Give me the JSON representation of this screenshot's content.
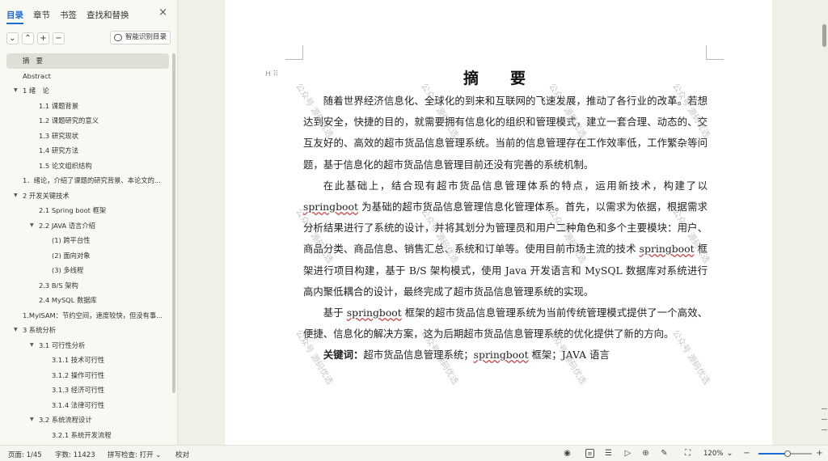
{
  "sidebar": {
    "tabs": [
      "目录",
      "章节",
      "书签",
      "查找和替换"
    ],
    "active_tab": 0,
    "close_icon": "×",
    "toolbar": {
      "collapse": "⌄",
      "expand": "⌃",
      "add": "+",
      "remove": "−",
      "smart_label": "智能识别目录"
    },
    "toc": [
      {
        "label": "摘　要",
        "level": 0,
        "selected": true
      },
      {
        "label": "Abstract",
        "level": 0
      },
      {
        "label": "1 绪　论",
        "level": 0,
        "arrow": true
      },
      {
        "label": "1.1 课题背景",
        "level": 1
      },
      {
        "label": "1.2 课题研究的意义",
        "level": 1
      },
      {
        "label": "1.3 研究现状",
        "level": 1
      },
      {
        "label": "1.4 研究方法",
        "level": 1
      },
      {
        "label": "1.5 论文组织结构",
        "level": 1
      },
      {
        "label": "1．绪论，介绍了课题的研究背景、本论文的...",
        "level": 0
      },
      {
        "label": "2 开发关键技术",
        "level": 0,
        "arrow": true
      },
      {
        "label": "2.1 Spring boot 框架",
        "level": 1
      },
      {
        "label": "2.2 JAVA 语言介绍",
        "level": 1,
        "arrow": true
      },
      {
        "label": "(1)  跨平台性",
        "level": 2
      },
      {
        "label": "(2)  面向对象",
        "level": 2
      },
      {
        "label": "(3)  多线程",
        "level": 2
      },
      {
        "label": "2.3 B/S 架构",
        "level": 1
      },
      {
        "label": "2.4 MySQL 数据库",
        "level": 1
      },
      {
        "label": "1.MyISAM：节约空间，速度较快，但没有事...",
        "level": 0
      },
      {
        "label": "3 系统分析",
        "level": 0,
        "arrow": true
      },
      {
        "label": "3.1 可行性分析",
        "level": 1,
        "arrow": true
      },
      {
        "label": "3.1.1 技术可行性",
        "level": 2
      },
      {
        "label": "3.1.2 操作可行性",
        "level": 2
      },
      {
        "label": "3.1.3 经济可行性",
        "level": 2
      },
      {
        "label": "3.1.4 法律可行性",
        "level": 2
      },
      {
        "label": "3.2 系统流程设计",
        "level": 1,
        "arrow": true
      },
      {
        "label": "3.2.1 系统开发流程",
        "level": 2
      }
    ]
  },
  "document": {
    "title": "摘　要",
    "p1": "随着世界经济信息化、全球化的到来和互联网的飞速发展，推动了各行业的改革。若想达到安全，快捷的目的，就需要拥有信息化的组织和管理模式，建立一套合理、动态的、交互友好的、高效的超市货品信息管理系统。当前的信息管理存在工作效率低，工作繁杂等问题，基于信息化的超市货品信息管理目前还没有完善的系统机制。",
    "p2a": "在此基础上，结合现有超市货品信息管理体系的特点，运用新技术，构建了以",
    "p2b": "springboot",
    "p2c": "为基础的超市货品信息管理信息化管理体系。首先，以需求为依据，根据需求分析结果进行了系统的设计，并将其划分为管理员和用户二种角色和多个主要模块：用户、商品分类、商品信息、销售汇总、系统和订单等。使用目前市场主流的技术",
    "p2d": "springboot",
    "p2e": "框架进行项目构建，基于 B/S 架构模式，使用 Java 开发语言和 MySQL 数据库对系统进行高内聚低耦合的设计，最终完成了超市货品信息管理系统的实现。",
    "p3a": "基于",
    "p3b": "springboot",
    "p3c": "框架的超市货品信息管理系统为当前传统管理模式提供了一个高效、便捷、信息化的解决方案，这为后期超市货品信息管理系统的优化提供了新的方向。",
    "kw_label": "关键词：",
    "kw_a": "超市货品信息管理系统；",
    "kw_b": "springboot",
    "kw_c": "框架；JAVA 语言",
    "watermark": "公众号 源码优选"
  },
  "statusbar": {
    "page": "页面: 1/45",
    "words": "字数: 11423",
    "spell": "拼写检查: 打开 ⌄",
    "proof": "校对",
    "zoom": "120%",
    "zoom_level": 0.55
  }
}
